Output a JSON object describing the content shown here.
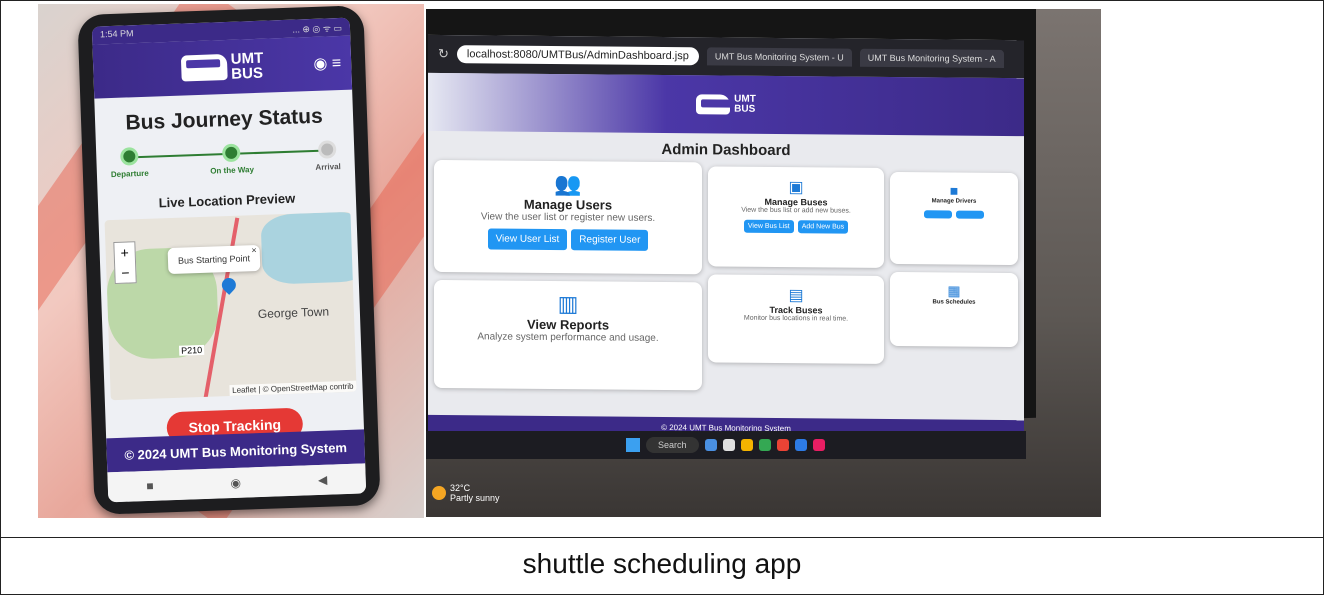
{
  "caption": "shuttle scheduling app",
  "phone": {
    "status_time": "1:54 PM",
    "status_icons": "... ⊕ ◎ ᯤ ▭",
    "logo_line1": "UMT",
    "logo_line2": "BUS",
    "header_icons": "◉ ≡",
    "journey_title": "Bus Journey Status",
    "steps": [
      {
        "label": "Departure",
        "active": true
      },
      {
        "label": "On the Way",
        "active": true
      },
      {
        "label": "Arrival",
        "active": false
      }
    ],
    "live_title": "Live Location Preview",
    "map": {
      "zoom_in": "+",
      "zoom_out": "−",
      "popup": "Bus Starting Point",
      "popup_close": "×",
      "place": "George Town",
      "road_label": "P210",
      "attribution": "Leaflet | © OpenStreetMap contrib"
    },
    "stop_button": "Stop Tracking",
    "footer": "© 2024 UMT Bus Monitoring System",
    "nav": [
      "■",
      "◉",
      "◀"
    ]
  },
  "laptop": {
    "tabs": [
      "UMT Bus Monitoring System - U",
      "UMT Bus Monitoring System - A"
    ],
    "url": "localhost:8080/UMTBus/AdminDashboard.jsp",
    "logo_line1": "UMT",
    "logo_line2": "BUS",
    "dashboard_title": "Admin Dashboard",
    "cards": [
      {
        "title": "Manage Users",
        "desc": "View the user list or register new users.",
        "icon": "users-icon",
        "buttons": [
          "View User List",
          "Register User"
        ]
      },
      {
        "title": "Manage Buses",
        "desc": "View the bus list or add new buses.",
        "icon": "bus-icon",
        "buttons": [
          "View Bus List",
          "Add New Bus"
        ]
      },
      {
        "title": "Manage Drivers",
        "desc": "",
        "icon": "driver-icon",
        "buttons": [
          "",
          ""
        ]
      },
      {
        "title": "View Reports",
        "desc": "Analyze system performance and usage.",
        "icon": "report-icon",
        "buttons": []
      },
      {
        "title": "Track Buses",
        "desc": "Monitor bus locations in real time.",
        "icon": "map-icon",
        "buttons": []
      },
      {
        "title": "Bus Schedules",
        "desc": "",
        "icon": "schedule-icon",
        "buttons": []
      }
    ],
    "footer": "© 2024 UMT Bus Monitoring System",
    "taskbar_search": "Search",
    "weather_temp": "32°C",
    "weather_desc": "Partly sunny"
  },
  "colors": {
    "brand_purple": "#3c2a88",
    "accent_blue": "#2196f3",
    "stop_red": "#e53935",
    "step_green": "#2e7d32"
  }
}
